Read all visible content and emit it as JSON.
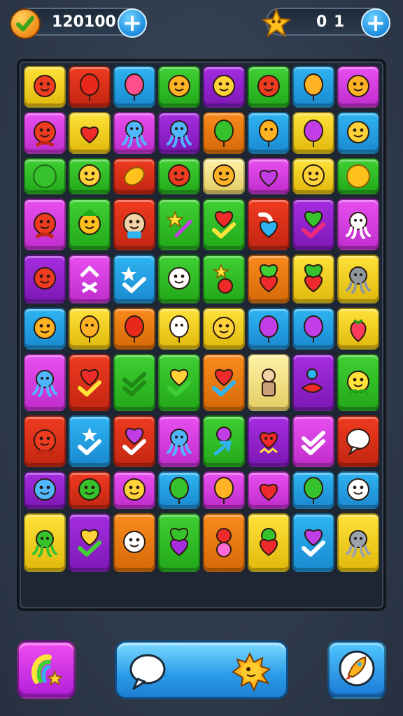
{
  "hud": {
    "score_value": "120100",
    "coins_value": "0 1",
    "left_badge_icon": "check-badge-icon",
    "right_badge_icon": "star-badge-icon"
  },
  "colors": {
    "red": "#ef3b1f",
    "orange": "#f98a1c",
    "yellow": "#ffe23a",
    "green": "#3fd033",
    "blue": "#2fb4f2",
    "purple": "#a52de0",
    "magenta": "#e84ff0",
    "cream": "#fff2a6"
  },
  "board": {
    "rows": [
      {
        "h": 66,
        "tiles": [
          {
            "c": "yellow",
            "icon": "red-bird"
          },
          {
            "c": "red",
            "icon": "red-balloon"
          },
          {
            "c": "blue",
            "icon": "pink-balloon"
          },
          {
            "c": "green",
            "icon": "orange-creature"
          },
          {
            "c": "purple",
            "icon": "yellow-face"
          },
          {
            "c": "green",
            "icon": "red-creature"
          },
          {
            "c": "blue",
            "icon": "orange-balloon"
          },
          {
            "c": "magenta",
            "icon": "orange-face"
          }
        ]
      },
      {
        "h": 66,
        "tiles": [
          {
            "c": "magenta",
            "icon": "mermaid"
          },
          {
            "c": "yellow",
            "icon": "red-heart"
          },
          {
            "c": "magenta",
            "icon": "blue-octopus"
          },
          {
            "c": "purple",
            "icon": "blue-octopus"
          },
          {
            "c": "orange",
            "icon": "green-balloon"
          },
          {
            "c": "blue",
            "icon": "orange-balloon-face"
          },
          {
            "c": "yellow",
            "icon": "purple-balloon"
          },
          {
            "c": "blue",
            "icon": "yellow-bird"
          }
        ]
      },
      {
        "h": 58,
        "tiles": [
          {
            "c": "green",
            "icon": "green-ball"
          },
          {
            "c": "green",
            "icon": "yellow-seahorse"
          },
          {
            "c": "red",
            "icon": "bread"
          },
          {
            "c": "green",
            "icon": "red-bird"
          },
          {
            "c": "cream",
            "icon": "orange-face"
          },
          {
            "c": "magenta",
            "icon": "purple-heart"
          },
          {
            "c": "yellow",
            "icon": "yellow-face"
          },
          {
            "c": "green",
            "icon": "yellow-ball"
          }
        ]
      },
      {
        "h": 80,
        "tiles": [
          {
            "c": "magenta",
            "icon": "red-girl"
          },
          {
            "c": "green",
            "icon": "green-gnome"
          },
          {
            "c": "red",
            "icon": "blue-boy"
          },
          {
            "c": "green",
            "icon": "star-wand"
          },
          {
            "c": "green",
            "icon": "heart-check"
          },
          {
            "c": "red",
            "icon": "candy-heart"
          },
          {
            "c": "purple",
            "icon": "heart-check-green"
          },
          {
            "c": "magenta",
            "icon": "white-octopus"
          }
        ]
      },
      {
        "h": 76,
        "tiles": [
          {
            "c": "purple",
            "icon": "red-bird"
          },
          {
            "c": "magenta",
            "icon": "white-arrows"
          },
          {
            "c": "blue",
            "icon": "white-stars"
          },
          {
            "c": "green",
            "icon": "white-bird"
          },
          {
            "c": "green",
            "icon": "star-apple"
          },
          {
            "c": "orange",
            "icon": "hearts"
          },
          {
            "c": "yellow",
            "icon": "green-red-hearts"
          },
          {
            "c": "yellow",
            "icon": "gray-monkey"
          }
        ]
      },
      {
        "h": 66,
        "tiles": [
          {
            "c": "blue",
            "icon": "orange-face"
          },
          {
            "c": "yellow",
            "icon": "orange-balloon-face"
          },
          {
            "c": "orange",
            "icon": "red-balloon"
          },
          {
            "c": "yellow",
            "icon": "white-balloon-face"
          },
          {
            "c": "yellow",
            "icon": "yellow-creature"
          },
          {
            "c": "blue",
            "icon": "purple-balloon"
          },
          {
            "c": "blue",
            "icon": "purple-balloon"
          },
          {
            "c": "yellow",
            "icon": "red-strawberry"
          }
        ]
      },
      {
        "h": 88,
        "tiles": [
          {
            "c": "magenta",
            "icon": "blue-octopus"
          },
          {
            "c": "red",
            "icon": "heart-check"
          },
          {
            "c": "green",
            "icon": "green-checks"
          },
          {
            "c": "green",
            "icon": "heart-check-yellow"
          },
          {
            "c": "orange",
            "icon": "heart-check-blue"
          },
          {
            "c": "cream",
            "icon": "doll"
          },
          {
            "c": "purple",
            "icon": "fish"
          },
          {
            "c": "green",
            "icon": "yellow-flower"
          }
        ]
      },
      {
        "h": 80,
        "tiles": [
          {
            "c": "red",
            "icon": "red-creature-white"
          },
          {
            "c": "blue",
            "icon": "white-star-check"
          },
          {
            "c": "red",
            "icon": "heart-check-purple"
          },
          {
            "c": "magenta",
            "icon": "blue-octopus"
          },
          {
            "c": "green",
            "icon": "balloon-arrow"
          },
          {
            "c": "purple",
            "icon": "red-heart-face"
          },
          {
            "c": "magenta",
            "icon": "white-checks"
          },
          {
            "c": "red",
            "icon": "white-speech"
          }
        ]
      },
      {
        "h": 60,
        "tiles": [
          {
            "c": "purple",
            "icon": "blue-face"
          },
          {
            "c": "red",
            "icon": "green-face"
          },
          {
            "c": "magenta",
            "icon": "yellow-bird"
          },
          {
            "c": "blue",
            "icon": "green-balloon"
          },
          {
            "c": "magenta",
            "icon": "orange-balloon"
          },
          {
            "c": "magenta",
            "icon": "red-heart"
          },
          {
            "c": "blue",
            "icon": "green-balloon"
          },
          {
            "c": "blue",
            "icon": "white-face"
          }
        ]
      },
      {
        "h": 90,
        "tiles": [
          {
            "c": "yellow",
            "icon": "green-octopus"
          },
          {
            "c": "purple",
            "icon": "heart-check-yellow"
          },
          {
            "c": "orange",
            "icon": "white-seahorse"
          },
          {
            "c": "green",
            "icon": "green-purple-hearts"
          },
          {
            "c": "orange",
            "icon": "red-pink-balloons"
          },
          {
            "c": "yellow",
            "icon": "green-red-balloons"
          },
          {
            "c": "blue",
            "icon": "heart-check-purple"
          },
          {
            "c": "yellow",
            "icon": "gray-octopus"
          }
        ]
      }
    ]
  },
  "controls": {
    "left_icon": "rainbow-star-icon",
    "mid_left_icon": "speech-bubble-icon",
    "mid_right_icon": "pufferfish-icon",
    "right_icon": "rocket-icon"
  }
}
